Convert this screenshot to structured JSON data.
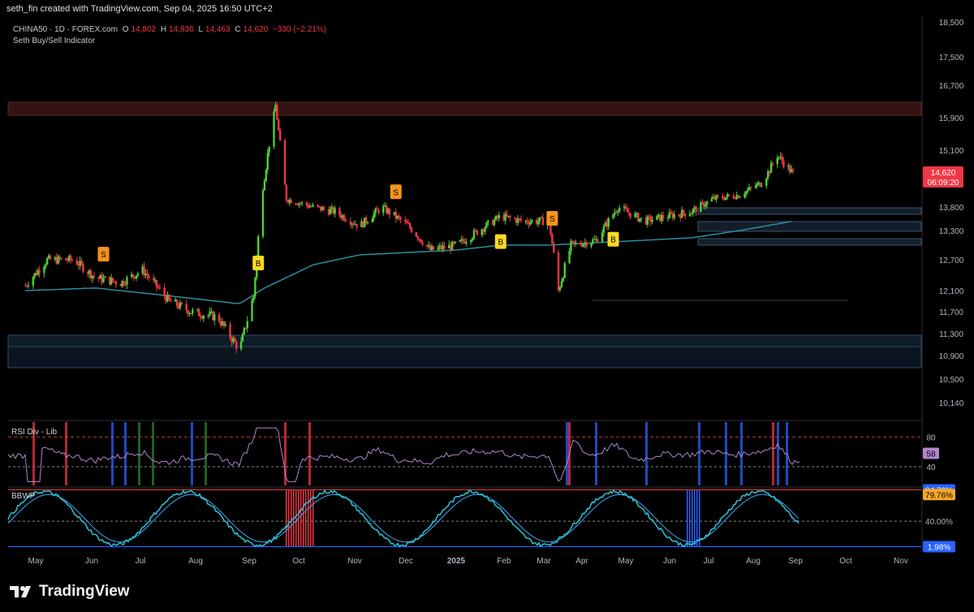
{
  "header": {
    "credit": "seth_fin created with TradingView.com, Sep 04, 2025 16:50 UTC+2",
    "symbol_line": "CHINA50 · 1D · FOREX.com",
    "o_label": "O",
    "o_value": "14,802",
    "h_label": "H",
    "h_value": "14,836",
    "l_label": "L",
    "l_value": "14,463",
    "c_label": "C",
    "c_value": "14,620",
    "change": "−330 (−2.21%)",
    "indicator": "Seth Buy/Sell Indicator"
  },
  "brand": {
    "name": "TradingView",
    "logo_icon": "tradingview-logo-icon"
  },
  "colors": {
    "up": "#26a69a",
    "up_bright": "#4cd137",
    "down": "#f23645",
    "ema": "#2a8ea0",
    "buy": "#f9d923",
    "sell": "#f7931a",
    "rsi": "#b084cc",
    "axis_text": "#b2b5be"
  },
  "chart_data": [
    {
      "type": "candlestick",
      "title": "CHINA50 · 1D · FOREX.com",
      "y_ticks": [
        10140,
        10500,
        10900,
        11300,
        11700,
        12100,
        12700,
        13300,
        13800,
        14620,
        15100,
        15900,
        16700,
        17500,
        18500
      ],
      "y_tick_labels": [
        "10,140",
        "10,500",
        "10,900",
        "11,300",
        "11,700",
        "12,100",
        "12,700",
        "13,300",
        "13,800",
        "14,620",
        "15,100",
        "15,900",
        "16,700",
        "17,500",
        "18,500"
      ],
      "x_ticks": [
        "May",
        "Jun",
        "Jul",
        "Aug",
        "Sep",
        "Oct",
        "Nov",
        "Dec",
        "2025",
        "Feb",
        "Mar",
        "Apr",
        "May",
        "Jun",
        "Jul",
        "Aug",
        "Sep",
        "Oct",
        "Nov"
      ],
      "last_price": "14,620",
      "countdown": "06:09:20",
      "close_path": [
        [
          "2024-05-01",
          12200
        ],
        [
          "2024-05-15",
          12700
        ],
        [
          "2024-06-01",
          12700
        ],
        [
          "2024-06-15",
          12350
        ],
        [
          "2024-07-01",
          12250
        ],
        [
          "2024-07-15",
          12500
        ],
        [
          "2024-08-01",
          11900
        ],
        [
          "2024-08-15",
          11700
        ],
        [
          "2024-09-01",
          11600
        ],
        [
          "2024-09-15",
          11000
        ],
        [
          "2024-09-24",
          12000
        ],
        [
          "2024-09-30",
          14300
        ],
        [
          "2024-10-08",
          16200
        ],
        [
          "2024-10-15",
          14000
        ],
        [
          "2024-11-01",
          13800
        ],
        [
          "2024-11-15",
          13700
        ],
        [
          "2024-12-01",
          13400
        ],
        [
          "2024-12-15",
          13800
        ],
        [
          "2025-01-01",
          13400
        ],
        [
          "2025-01-15",
          12900
        ],
        [
          "2025-02-01",
          13000
        ],
        [
          "2025-02-15",
          13300
        ],
        [
          "2025-03-01",
          13600
        ],
        [
          "2025-03-15",
          13500
        ],
        [
          "2025-04-01",
          13500
        ],
        [
          "2025-04-07",
          12100
        ],
        [
          "2025-04-15",
          13000
        ],
        [
          "2025-05-01",
          13100
        ],
        [
          "2025-05-15",
          13800
        ],
        [
          "2025-06-01",
          13500
        ],
        [
          "2025-06-15",
          13600
        ],
        [
          "2025-07-01",
          13700
        ],
        [
          "2025-07-15",
          14000
        ],
        [
          "2025-08-01",
          14100
        ],
        [
          "2025-08-15",
          14400
        ],
        [
          "2025-08-25",
          15000
        ],
        [
          "2025-09-04",
          14620
        ]
      ],
      "ema_path": [
        [
          "2024-05-01",
          12100
        ],
        [
          "2024-06-15",
          12150
        ],
        [
          "2024-08-01",
          12000
        ],
        [
          "2024-09-15",
          11850
        ],
        [
          "2024-10-01",
          12150
        ],
        [
          "2024-11-01",
          12600
        ],
        [
          "2024-12-01",
          12800
        ],
        [
          "2025-01-01",
          12850
        ],
        [
          "2025-02-01",
          12900
        ],
        [
          "2025-03-01",
          13000
        ],
        [
          "2025-04-01",
          13000
        ],
        [
          "2025-05-01",
          13050
        ],
        [
          "2025-06-01",
          13100
        ],
        [
          "2025-07-01",
          13150
        ],
        [
          "2025-08-01",
          13300
        ],
        [
          "2025-09-04",
          13500
        ]
      ],
      "signals": [
        {
          "date": "2024-06-20",
          "type": "sell",
          "label": "S"
        },
        {
          "date": "2024-09-27",
          "type": "buy",
          "label": "B"
        },
        {
          "date": "2024-12-24",
          "type": "sell",
          "label": "S"
        },
        {
          "date": "2025-03-01",
          "type": "buy",
          "label": "B"
        },
        {
          "date": "2025-04-03",
          "type": "sell",
          "label": "S"
        },
        {
          "date": "2025-05-12",
          "type": "buy",
          "label": "B"
        }
      ]
    },
    {
      "type": "line",
      "title": "RSI Div - Lib",
      "y_ticks": [
        40,
        80
      ],
      "current_value": "58"
    },
    {
      "type": "line",
      "title": "BBWP",
      "y_ticks": [
        "40.00%"
      ],
      "labels": [
        "84.76%",
        "79.76%",
        "1.98%"
      ]
    }
  ]
}
